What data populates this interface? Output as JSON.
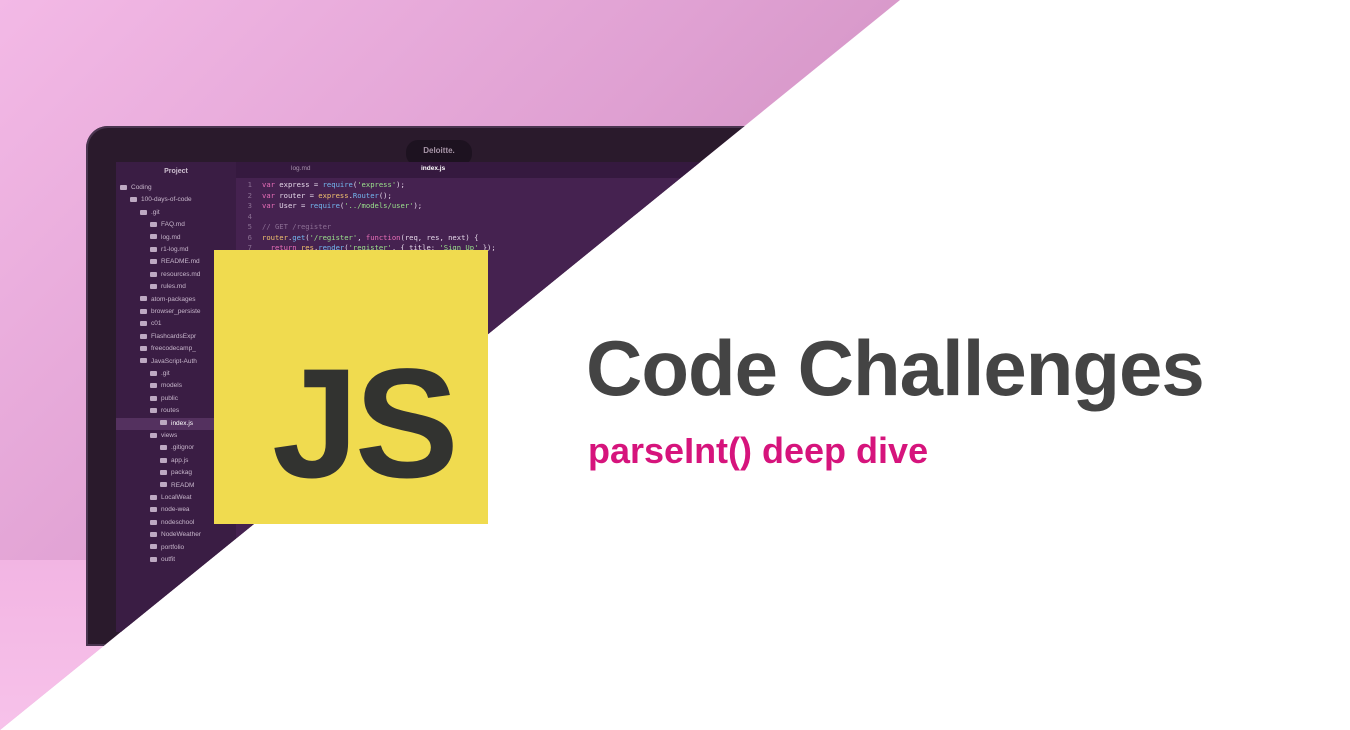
{
  "banner": {
    "title": "Code Challenges",
    "subtitle": "parseInt() deep dive",
    "logo_text": "JS",
    "colors": {
      "title": "#444444",
      "subtitle": "#d6147c",
      "logo_bg": "#f0db4f",
      "logo_text": "#323330",
      "photo_tint": "#dfa0d2"
    }
  },
  "laptop": {
    "brand": "Deloitte.",
    "sidebar_title": "Project",
    "tabs": [
      "log.md",
      "index.js"
    ],
    "tree": [
      {
        "label": "Coding",
        "icon": "folder-icon"
      },
      {
        "label": "100-days-of-code",
        "icon": "folder-icon"
      },
      {
        "label": ".git",
        "icon": "folder-icon"
      },
      {
        "label": "FAQ.md",
        "icon": "file-icon"
      },
      {
        "label": "log.md",
        "icon": "file-icon"
      },
      {
        "label": "r1-log.md",
        "icon": "file-icon"
      },
      {
        "label": "README.md",
        "icon": "file-icon"
      },
      {
        "label": "resources.md",
        "icon": "file-icon"
      },
      {
        "label": "rules.md",
        "icon": "file-icon"
      },
      {
        "label": "atom-packages",
        "icon": "folder-icon"
      },
      {
        "label": "browser_persiste",
        "icon": "folder-icon"
      },
      {
        "label": "c01",
        "icon": "folder-icon"
      },
      {
        "label": "FlashcardsExpr",
        "icon": "folder-icon"
      },
      {
        "label": "freecodecamp_",
        "icon": "folder-icon"
      },
      {
        "label": "JavaScript-Auth",
        "icon": "folder-icon"
      },
      {
        "label": ".git",
        "icon": "folder-icon"
      },
      {
        "label": "models",
        "icon": "folder-icon"
      },
      {
        "label": "public",
        "icon": "folder-icon"
      },
      {
        "label": "routes",
        "icon": "folder-icon"
      },
      {
        "label": "index.js",
        "icon": "file-icon"
      },
      {
        "label": "views",
        "icon": "folder-icon"
      },
      {
        "label": ".gitignor",
        "icon": "file-icon"
      },
      {
        "label": "app.js",
        "icon": "file-icon"
      },
      {
        "label": "packag",
        "icon": "file-icon"
      },
      {
        "label": "READM",
        "icon": "file-icon"
      },
      {
        "label": "LocalWeat",
        "icon": "folder-icon"
      },
      {
        "label": "node-wea",
        "icon": "folder-icon"
      },
      {
        "label": "nodeschool",
        "icon": "folder-icon"
      },
      {
        "label": "NodeWeather",
        "icon": "folder-icon"
      },
      {
        "label": "portfolio",
        "icon": "folder-icon"
      },
      {
        "label": "outfit",
        "icon": "folder-icon"
      }
    ],
    "code": [
      {
        "n": "1",
        "text": "var express = require('express');"
      },
      {
        "n": "2",
        "text": "var router = express.Router();"
      },
      {
        "n": "3",
        "text": "var User = require('../models/user');"
      },
      {
        "n": "4",
        "text": ""
      },
      {
        "n": "5",
        "text": "// GET /register"
      },
      {
        "n": "6",
        "text": "router.get('/register', function(req, res, next) {"
      },
      {
        "n": "7",
        "text": "  return res.render('register', { title: 'Sign Up' });"
      }
    ]
  }
}
